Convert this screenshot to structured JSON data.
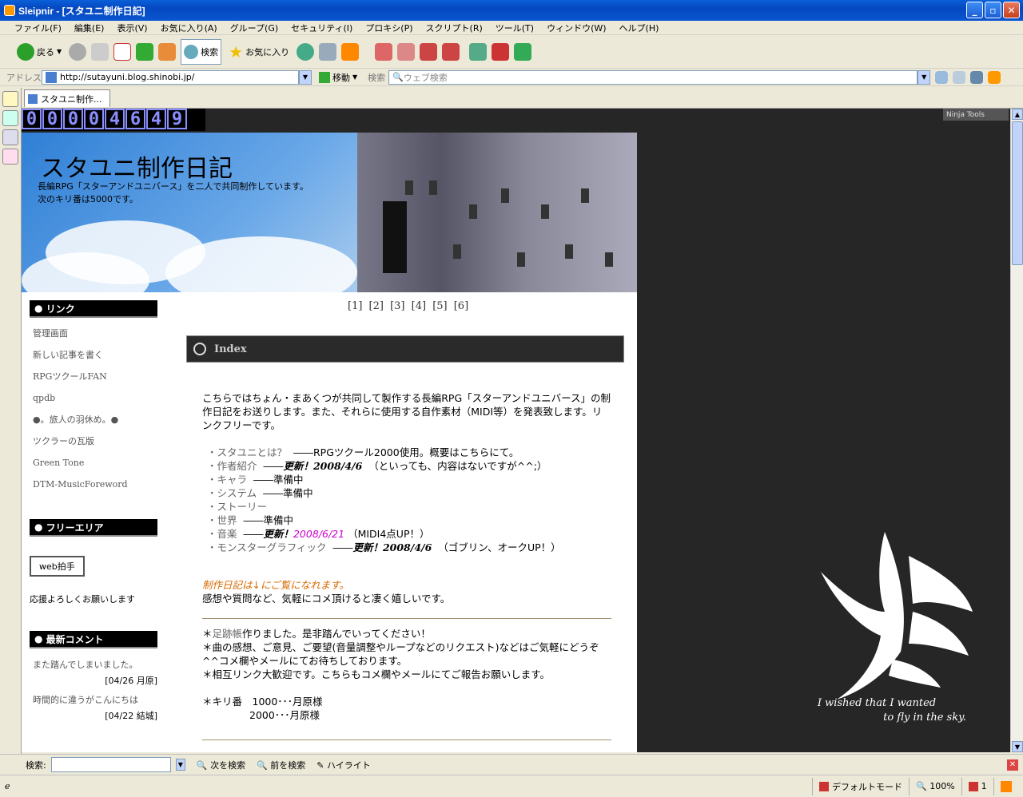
{
  "window": {
    "title": "Sleipnir - [スタユニ制作日記]",
    "btn_min": "_",
    "btn_max": "▫",
    "btn_close": "✕"
  },
  "menu": [
    "ファイル(F)",
    "編集(E)",
    "表示(V)",
    "お気に入り(A)",
    "グループ(G)",
    "セキュリティ(I)",
    "プロキシ(P)",
    "スクリプト(R)",
    "ツール(T)",
    "ウィンドウ(W)",
    "ヘルプ(H)"
  ],
  "toolbar": {
    "back": "戻る",
    "search": "検索",
    "favorites": "お気に入り"
  },
  "address": {
    "label": "アドレス",
    "url": "http://sutayuni.blog.shinobi.jp/",
    "go": "移動",
    "search_label": "検索",
    "search_placeholder": "ウェブ検索"
  },
  "tab": {
    "title": "スタユニ制作..."
  },
  "page": {
    "counter": [
      "0",
      "0",
      "0",
      "0",
      "4",
      "6",
      "4",
      "9"
    ],
    "ninja": "Ninja Tools",
    "title": "スタユニ制作日記",
    "desc1": "長編RPG「スターアンドユニバース」を二人で共同制作しています。",
    "desc2": "次のキリ番は5000です。",
    "pager": "[1] [2] [3] [4] [5] [6]",
    "sidebar": {
      "links_title": "リンク",
      "links": [
        "管理画面",
        "新しい記事を書く",
        "RPGツクールFAN",
        "qpdb",
        "●。旅人の羽休め。●",
        "ツクラーの瓦版",
        "Green Tone",
        "DTM-MusicForeword"
      ],
      "free_title": "フリーエリア",
      "webclap": "web拍手",
      "cheer": "応援よろしくお願いします",
      "comments_title": "最新コメント",
      "comment1": "また踏んでしまいました。",
      "comment1_meta": "[04/26 月原]",
      "comment2": "時間的に違うがこんにちは",
      "comment2_meta": "[04/22 結城]"
    },
    "entry": {
      "heading": "Index",
      "intro": "こちらではちょん・まあくつが共同して製作する長編RPG「スターアンドユニバース」の制作日記をお送りします。また、それらに使用する自作素材（MIDI等）を発表致します。リンクフリーです。",
      "l1a": "・スタユニとは？",
      "l1b": "――RPGツクール2000使用。概要はこちらにて。",
      "l2a": "・作者紹介",
      "l2b": "――",
      "l2c": "更新！2008/4/6",
      "l2d": "（といっても、内容はないですが^^;）",
      "l3a": "・キャラ",
      "l3b": "――準備中",
      "l4a": "・システム",
      "l4b": "――準備中",
      "l5a": "・ストーリー",
      "l6a": "・世界",
      "l6b": "――準備中",
      "l7a": "・音楽",
      "l7b": "――",
      "l7c": "更新！",
      "l7d": "2008/6/21",
      "l7e": "（MIDI4点UP！）",
      "l8a": "・モンスターグラフィック",
      "l8b": "――",
      "l8c": "更新！2008/4/6",
      "l8d": "（ゴブリン、オークUP！）",
      "notice": "制作日記は↓にご覧になれます。",
      "notice2": "感想や質問など、気軽にコメ頂けると凄く嬉しいです。",
      "p1a": "＊",
      "p1b": "足跡帳",
      "p1c": "作りました。是非踏んでいってください！",
      "p2": "＊曲の感想、ご意見、ご要望(音量調整やループなどのリクエスト)などはご気軽にどうぞ^^コメ欄やメールにてお待ちしております。",
      "p3": "＊相互リンク大歓迎です。こちらもコメ欄やメールにてご報告お願いします。",
      "kiri1": "＊キリ番　1000･･･月原様",
      "kiri2": "2000･･･月原様"
    },
    "wing_caption1": "I wished that I wanted",
    "wing_caption2": "to fly in the sky."
  },
  "find": {
    "label": "検索:",
    "next": "次を検索",
    "prev": "前を検索",
    "highlight": "ハイライト"
  },
  "status": {
    "mode": "デフォルトモード",
    "zoom": "100%",
    "count": "1"
  }
}
